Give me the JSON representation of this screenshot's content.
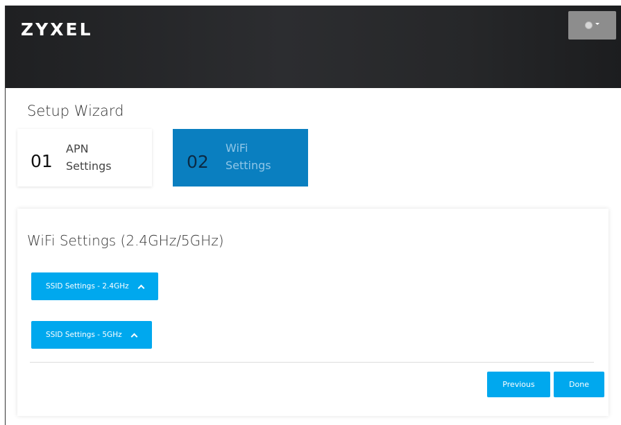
{
  "header": {
    "brand": "ZYXEL",
    "language_icon": "globe-icon"
  },
  "wizard": {
    "title": "Setup Wizard",
    "steps": [
      {
        "number": "01",
        "label_line1": "APN",
        "label_line2": "Settings",
        "active": false
      },
      {
        "number": "02",
        "label_line1": "WiFi",
        "label_line2": "Settings",
        "active": true
      }
    ]
  },
  "panel": {
    "title": "WiFi Settings (2.4GHz/5GHz)",
    "ssid_24": "SSID Settings - 2.4GHz",
    "ssid_5": "SSID Settings - 5GHz",
    "previous_label": "Previous",
    "done_label": "Done"
  },
  "colors": {
    "header_bg": "#26272a",
    "active_step": "#0a7fc0",
    "button": "#00a8ee"
  }
}
